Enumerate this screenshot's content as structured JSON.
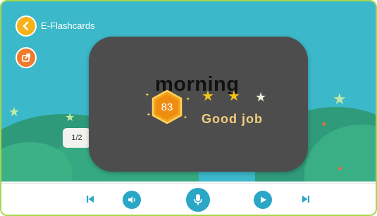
{
  "header": {
    "title": "E-Flashcards"
  },
  "card": {
    "word": "morning",
    "score": "83",
    "stars_earned": 2,
    "stars_total": 3,
    "feedback": "Good job"
  },
  "pagination": {
    "label": "1/2"
  },
  "colors": {
    "stage_bg": "#3bb8c9",
    "card_bg": "#4d4d4d",
    "accent_blue": "#2aa6c6",
    "back_button": "#f7b21a",
    "share_button": "#f07b2d",
    "star_gold": "#f2c41a",
    "feedback_text": "#f4cd7f",
    "frame_border": "#a7d64a"
  },
  "icons": {
    "back": "chevron-left-icon",
    "share": "share-icon",
    "previous": "skip-previous-icon",
    "audio": "speaker-icon",
    "record": "microphone-icon",
    "play": "play-icon",
    "next": "skip-next-icon"
  }
}
